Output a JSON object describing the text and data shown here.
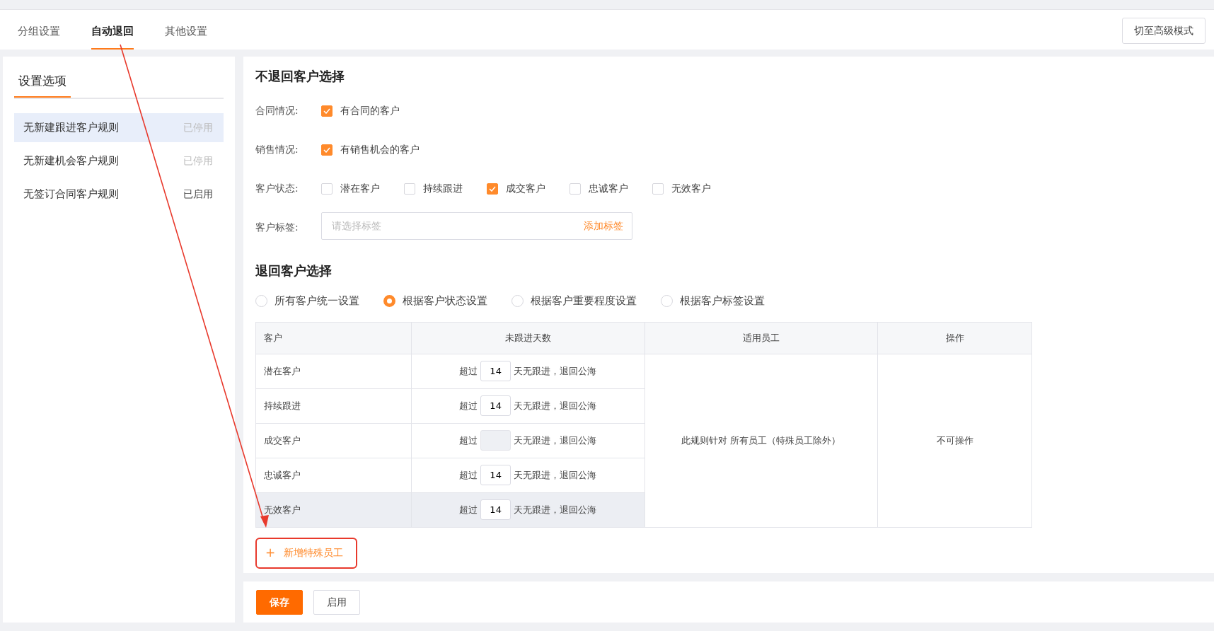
{
  "tabs": [
    {
      "label": "分组设置",
      "selected": false
    },
    {
      "label": "自动退回",
      "selected": true
    },
    {
      "label": "其他设置",
      "selected": false
    }
  ],
  "mode_button": "切至高级模式",
  "sidebar": {
    "title": "设置选项",
    "items": [
      {
        "label": "无新建跟进客户规则",
        "status": "已停用",
        "enabled": false,
        "selected": true
      },
      {
        "label": "无新建机会客户规则",
        "status": "已停用",
        "enabled": false,
        "selected": false
      },
      {
        "label": "无签订合同客户规则",
        "status": "已启用",
        "enabled": true,
        "selected": false
      }
    ]
  },
  "keep_section": {
    "title": "不退回客户选择",
    "fields": [
      {
        "kind": "checks",
        "label": "合同情况:",
        "options": [
          {
            "label": "有合同的客户",
            "checked": true
          }
        ]
      },
      {
        "kind": "checks",
        "label": "销售情况:",
        "options": [
          {
            "label": "有销售机会的客户",
            "checked": true
          }
        ]
      },
      {
        "kind": "checks",
        "label": "客户状态:",
        "options": [
          {
            "label": "潜在客户",
            "checked": false
          },
          {
            "label": "持续跟进",
            "checked": false
          },
          {
            "label": "成交客户",
            "checked": true
          },
          {
            "label": "忠诚客户",
            "checked": false
          },
          {
            "label": "无效客户",
            "checked": false
          }
        ]
      },
      {
        "kind": "tags",
        "label": "客户标签:",
        "placeholder": "请选择标签",
        "action": "添加标签"
      }
    ]
  },
  "return_section": {
    "title": "退回客户选择",
    "modes": [
      {
        "label": "所有客户统一设置",
        "selected": false
      },
      {
        "label": "根据客户状态设置",
        "selected": true
      },
      {
        "label": "根据客户重要程度设置",
        "selected": false
      },
      {
        "label": "根据客户标签设置",
        "selected": false
      }
    ],
    "table": {
      "columns": [
        "客户",
        "未跟进天数",
        "适用员工",
        "操作"
      ],
      "rows": [
        {
          "customer": "潜在客户",
          "prefix": "超过",
          "days": "14",
          "suffix": "天无跟进，退回公海",
          "disabled": false,
          "hovered": false
        },
        {
          "customer": "持续跟进",
          "prefix": "超过",
          "days": "14",
          "suffix": "天无跟进，退回公海",
          "disabled": false,
          "hovered": false
        },
        {
          "customer": "成交客户",
          "prefix": "超过",
          "suffix": "天无跟进，退回公海",
          "disabled": true,
          "hovered": false
        },
        {
          "customer": "忠诚客户",
          "prefix": "超过",
          "days": "14",
          "suffix": "天无跟进，退回公海",
          "disabled": false,
          "hovered": false
        },
        {
          "customer": "无效客户",
          "prefix": "超过",
          "days": "14",
          "suffix": "天无跟进，退回公海",
          "disabled": false,
          "hovered": true
        }
      ],
      "staff": "此规则针对 所有员工（特殊员工除外）",
      "operation": "不可操作"
    },
    "add_button": {
      "icon": "+",
      "label": "新增特殊员工"
    }
  },
  "footer": {
    "buttons": [
      {
        "label": "保存",
        "kind": "primary"
      },
      {
        "label": "启用",
        "kind": "default"
      }
    ]
  },
  "annotation": {
    "arrow": true,
    "highlight": true
  }
}
